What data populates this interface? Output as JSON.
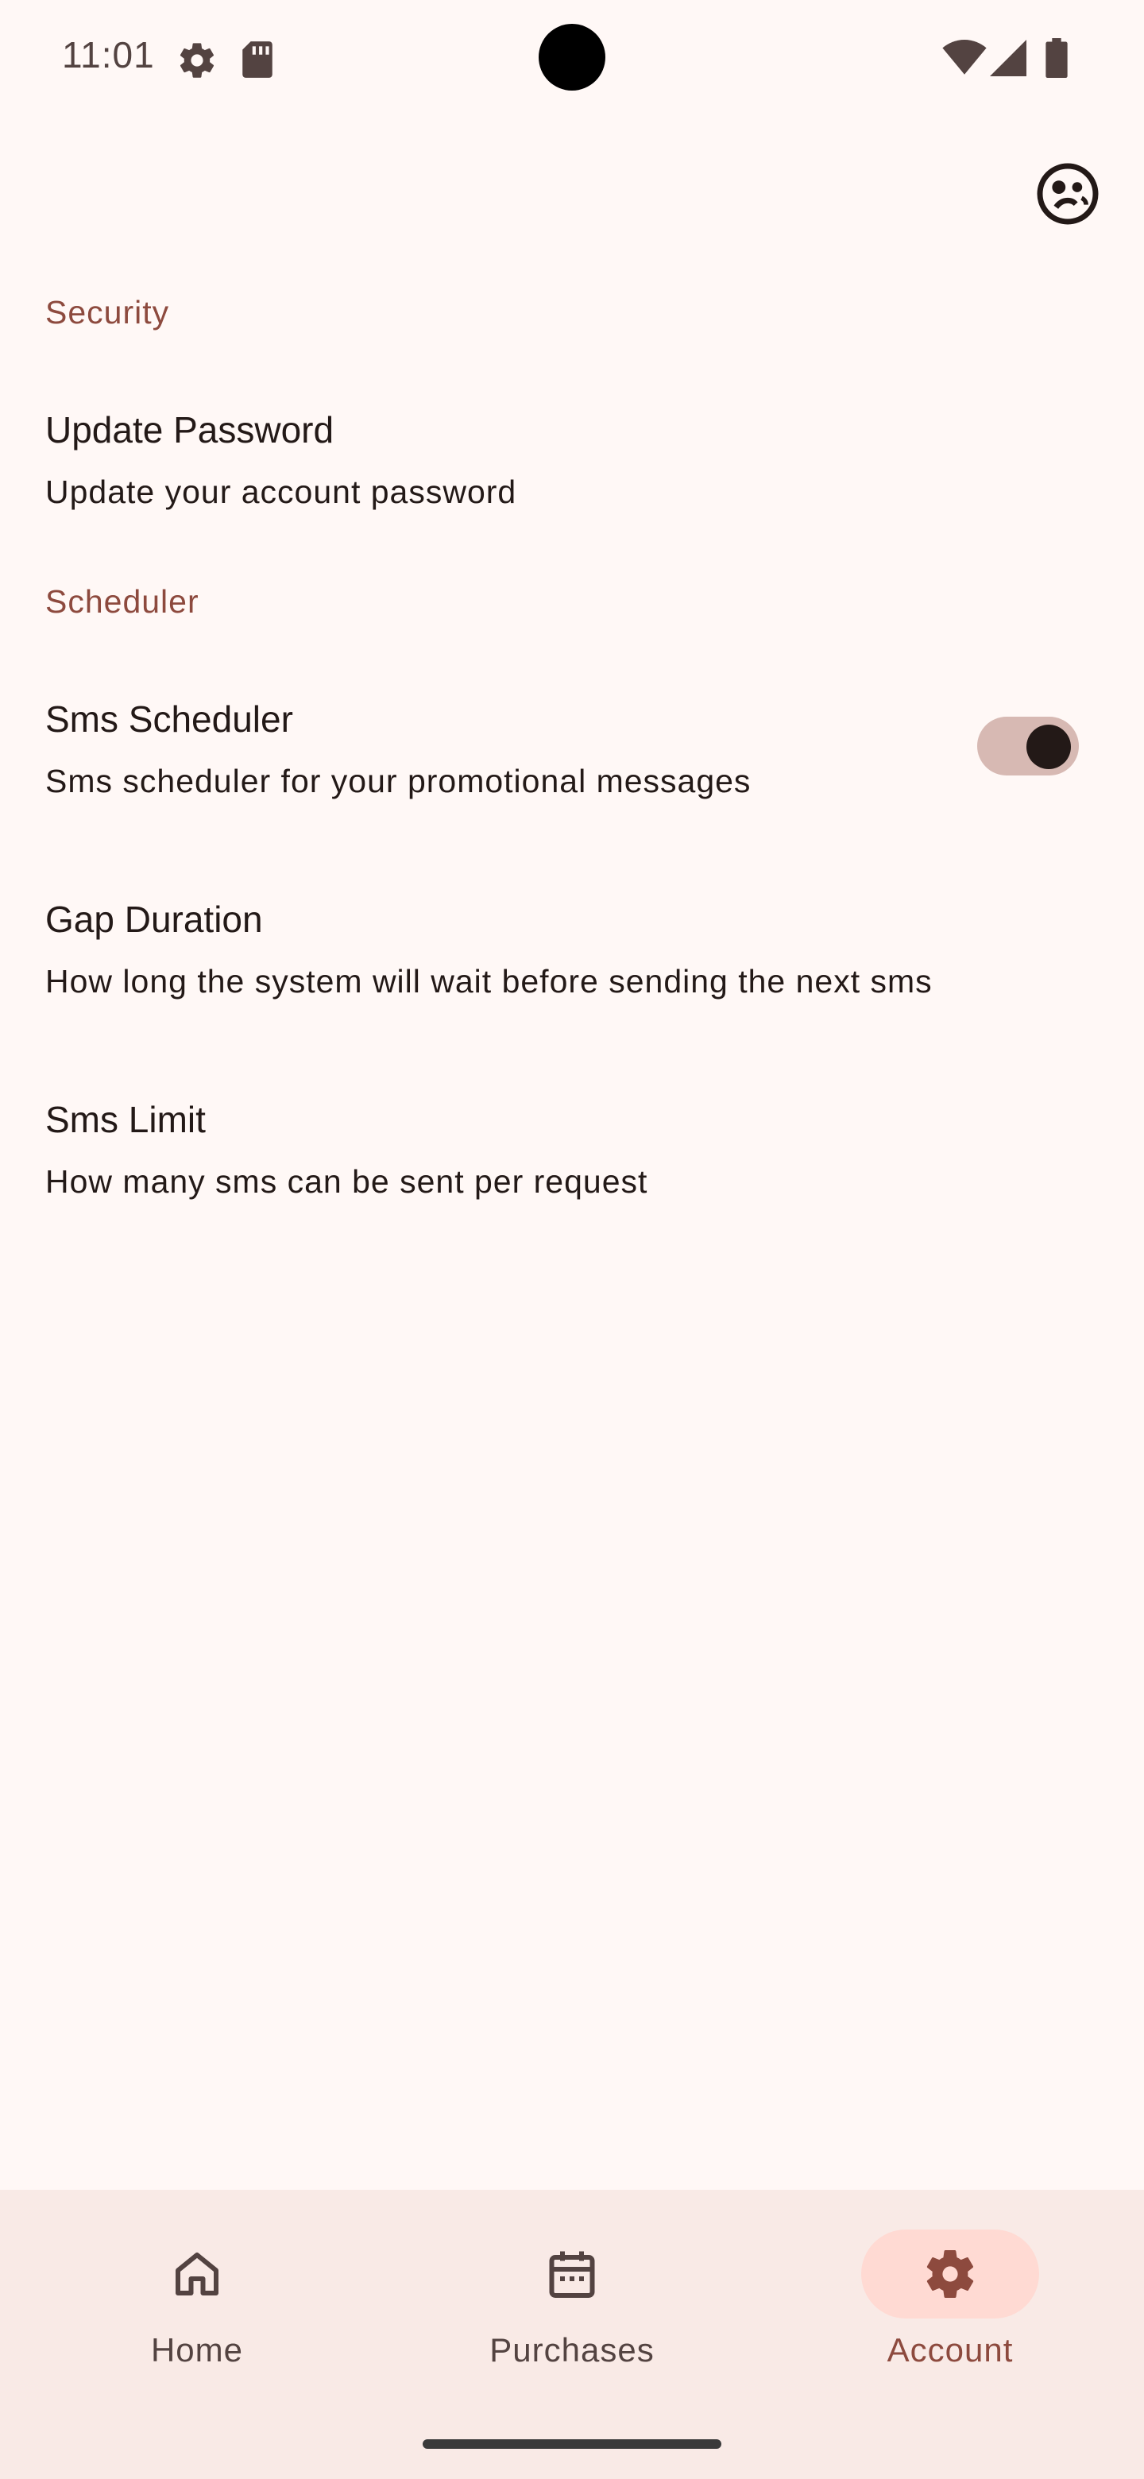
{
  "status_bar": {
    "time": "11:01",
    "icons": [
      "settings-gear-icon",
      "sd-card-icon",
      "wifi-icon",
      "cell-signal-icon",
      "battery-icon"
    ]
  },
  "top_bar": {
    "action_icon": "theme-face-icon"
  },
  "sections": {
    "security": {
      "title": "Security",
      "items": [
        {
          "title": "Update Password",
          "subtitle": "Update your account password"
        }
      ]
    },
    "scheduler": {
      "title": "Scheduler",
      "items": [
        {
          "title": "Sms Scheduler",
          "subtitle": "Sms scheduler for your promotional messages",
          "toggle_on": true
        },
        {
          "title": "Gap Duration",
          "subtitle": "How long the system will wait before sending the next sms"
        },
        {
          "title": "Sms Limit",
          "subtitle": "How many sms can be sent per request"
        }
      ]
    }
  },
  "bottom_nav": {
    "items": [
      {
        "label": "Home",
        "icon": "home-icon",
        "active": false
      },
      {
        "label": "Purchases",
        "icon": "calendar-icon",
        "active": false
      },
      {
        "label": "Account",
        "icon": "settings-icon",
        "active": true
      }
    ]
  },
  "colors": {
    "background": "#FFF8F6",
    "accent": "#8D4A3E",
    "nav_background": "#F9EAE6",
    "active_pill": "#FFDAD3",
    "toggle_track": "#D7B9B3"
  }
}
